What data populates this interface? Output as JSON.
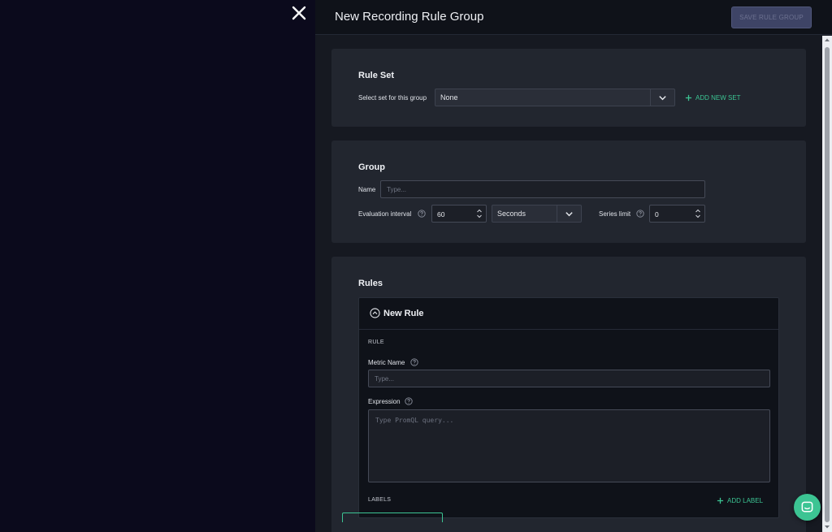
{
  "drawer": {
    "title": "New Recording Rule Group",
    "save_label": "SAVE RULE GROUP",
    "close_icon": "close-icon"
  },
  "rule_set": {
    "title": "Rule Set",
    "select_label": "Select set for this group",
    "selected_value": "None",
    "add_new_set_label": "ADD NEW SET"
  },
  "group": {
    "title": "Group",
    "name_label": "Name",
    "name_placeholder": "Type...",
    "eval_label": "Evaluation interval",
    "eval_value": "60",
    "eval_unit": "Seconds",
    "series_limit_label": "Series limit",
    "series_limit_value": "0"
  },
  "rules": {
    "title": "Rules",
    "rule_title": "New Rule",
    "rule_section_label": "RULE",
    "metric_name_label": "Metric Name",
    "metric_name_placeholder": "Type...",
    "expression_label": "Expression",
    "expression_placeholder": "Type PromQL query...",
    "labels_section_label": "LABELS",
    "add_label_label": "ADD LABEL"
  },
  "colors": {
    "accent": "#3cc493",
    "backdrop": "#0b0a1c",
    "panel": "#22262f",
    "save_button_disabled": "#3e4466"
  }
}
